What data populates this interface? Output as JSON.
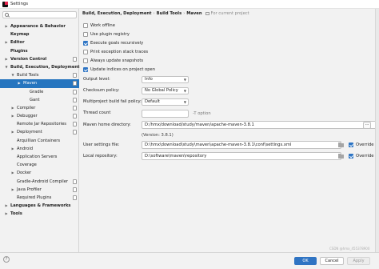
{
  "window": {
    "title": "Settings"
  },
  "sidebar": {
    "items": [
      {
        "label": "Appearance & Behavior",
        "arrow": "▶",
        "bold": true
      },
      {
        "label": "Keymap",
        "arrow": "",
        "bold": true
      },
      {
        "label": "Editor",
        "arrow": "▶",
        "bold": true
      },
      {
        "label": "Plugins",
        "arrow": "",
        "bold": true
      },
      {
        "label": "Version Control",
        "arrow": "▶",
        "bold": true
      },
      {
        "label": "Build, Execution, Deployment",
        "arrow": "▼",
        "bold": true
      },
      {
        "label": "Build Tools",
        "arrow": "▼",
        "bold": false
      },
      {
        "label": "Maven",
        "arrow": "▶",
        "bold": false,
        "selected": true
      },
      {
        "label": "Gradle",
        "arrow": "",
        "bold": false
      },
      {
        "label": "Gant",
        "arrow": "",
        "bold": false
      },
      {
        "label": "Compiler",
        "arrow": "▶",
        "bold": false
      },
      {
        "label": "Debugger",
        "arrow": "▶",
        "bold": false
      },
      {
        "label": "Remote Jar Repositories",
        "arrow": "",
        "bold": false
      },
      {
        "label": "Deployment",
        "arrow": "▶",
        "bold": false
      },
      {
        "label": "Arquillian Containers",
        "arrow": "",
        "bold": false
      },
      {
        "label": "Android",
        "arrow": "▶",
        "bold": false
      },
      {
        "label": "Application Servers",
        "arrow": "",
        "bold": false
      },
      {
        "label": "Coverage",
        "arrow": "",
        "bold": false
      },
      {
        "label": "Docker",
        "arrow": "▶",
        "bold": false
      },
      {
        "label": "Gradle-Android Compiler",
        "arrow": "",
        "bold": false
      },
      {
        "label": "Java Profiler",
        "arrow": "▶",
        "bold": false
      },
      {
        "label": "Required Plugins",
        "arrow": "",
        "bold": false
      },
      {
        "label": "Languages & Frameworks",
        "arrow": "▶",
        "bold": true
      },
      {
        "label": "Tools",
        "arrow": "▶",
        "bold": true
      }
    ]
  },
  "breadcrumb": {
    "part1": "Build, Execution, Deployment",
    "part2": "Build Tools",
    "part3": "Maven",
    "separator": "›",
    "project_note": "For current project"
  },
  "options": {
    "work_offline": {
      "label": "Work offline",
      "checked": false
    },
    "use_plugin_registry": {
      "label": "Use plugin registry",
      "checked": false
    },
    "execute_goals_recursively": {
      "label": "Execute goals recursively",
      "checked": true
    },
    "print_exception_stack_traces": {
      "label": "Print exception stack traces",
      "checked": false
    },
    "always_update_snapshots": {
      "label": "Always update snapshots",
      "checked": false
    },
    "update_indices": {
      "label": "Update indices on project open",
      "checked": true
    }
  },
  "fields": {
    "output_level": {
      "label": "Output level:",
      "value": "Info"
    },
    "checksum_policy": {
      "label": "Checksum policy:",
      "value": "No Global Policy"
    },
    "multiproject_fail_policy": {
      "label": "Multiproject build fail policy:",
      "value": "Default"
    },
    "thread_count": {
      "label": "Thread count",
      "value": "",
      "hint": "-T option"
    },
    "maven_home": {
      "label": "Maven home directory:",
      "value": "D:/hmx/download/study/maven/apache-maven-3.8.1",
      "version": "(Version: 3.8.1)",
      "more_label": "..."
    },
    "user_settings": {
      "label": "User settings file:",
      "value": "D:\\hmx\\download\\study\\maven\\apache-maven-3.8.1\\conf\\settings.xml",
      "override_label": "Override"
    },
    "local_repository": {
      "label": "Local repository:",
      "value": "D:\\software\\maven\\repository",
      "override_label": "Override"
    }
  },
  "footer": {
    "help": "?",
    "ok": "OK",
    "cancel": "Cancel",
    "apply": "Apply",
    "watermark": "CSDN @hmx_455378900"
  },
  "colors": {
    "accent": "#2675bf",
    "button_primary": "#2f74c3",
    "checkbox_on": "#2d74c4"
  }
}
